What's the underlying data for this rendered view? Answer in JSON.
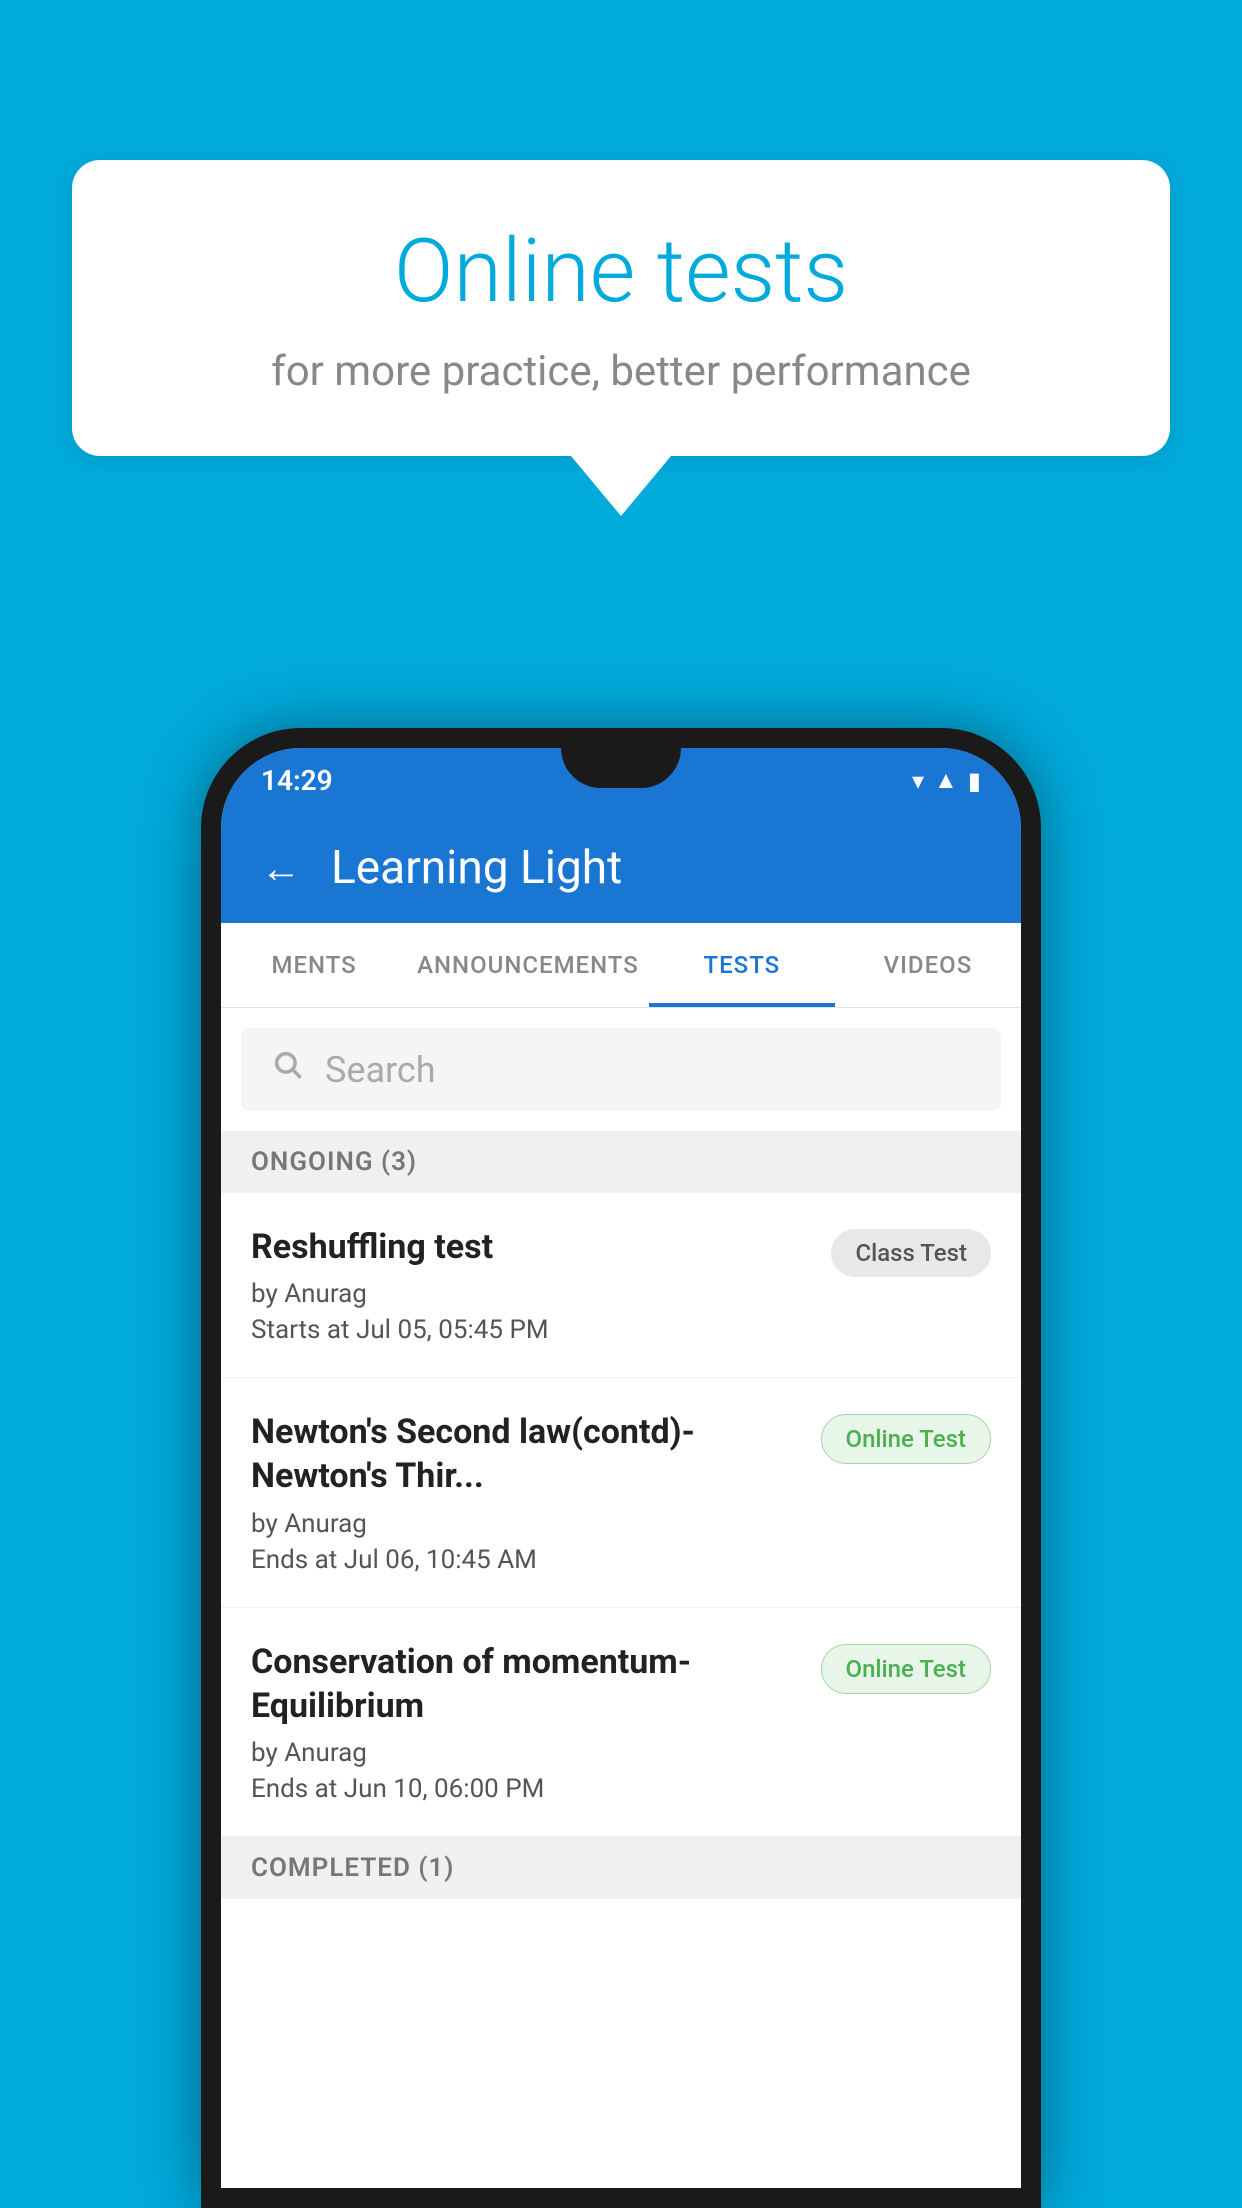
{
  "background_color": "#00AADB",
  "bubble": {
    "title": "Online tests",
    "subtitle": "for more practice, better performance"
  },
  "phone": {
    "status_bar": {
      "time": "14:29",
      "icons": [
        "wifi",
        "signal",
        "battery"
      ]
    },
    "app_bar": {
      "title": "Learning Light",
      "back_label": "←"
    },
    "tabs": [
      {
        "label": "MENTS",
        "active": false
      },
      {
        "label": "ANNOUNCEMENTS",
        "active": false
      },
      {
        "label": "TESTS",
        "active": true
      },
      {
        "label": "VIDEOS",
        "active": false
      }
    ],
    "search": {
      "placeholder": "Search"
    },
    "ongoing_section": {
      "label": "ONGOING (3)"
    },
    "tests": [
      {
        "name": "Reshuffling test",
        "author": "by Anurag",
        "time_label": "Starts at  Jul 05, 05:45 PM",
        "badge": "Class Test",
        "badge_type": "class"
      },
      {
        "name": "Newton's Second law(contd)-Newton's Thir...",
        "author": "by Anurag",
        "time_label": "Ends at  Jul 06, 10:45 AM",
        "badge": "Online Test",
        "badge_type": "online"
      },
      {
        "name": "Conservation of momentum-Equilibrium",
        "author": "by Anurag",
        "time_label": "Ends at  Jun 10, 06:00 PM",
        "badge": "Online Test",
        "badge_type": "online"
      }
    ],
    "completed_section": {
      "label": "COMPLETED (1)"
    }
  }
}
